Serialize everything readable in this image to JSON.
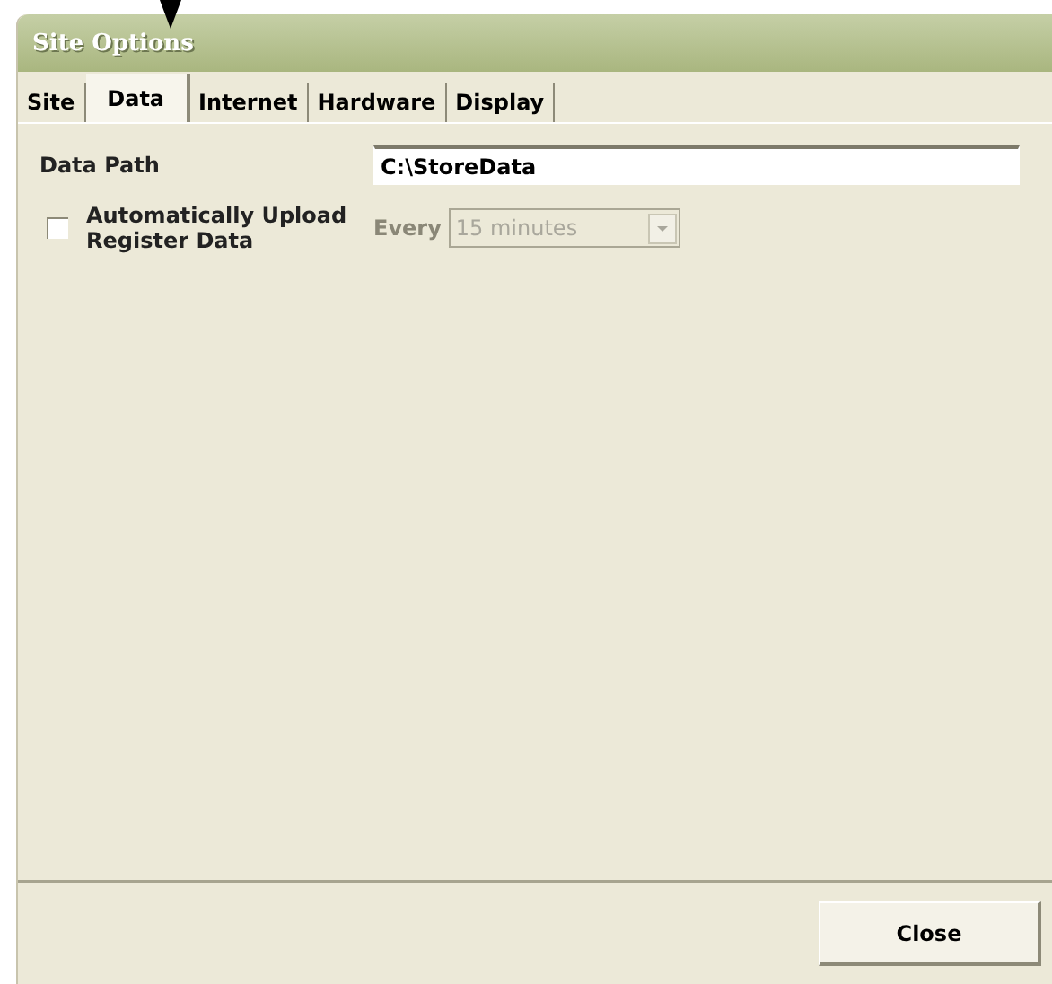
{
  "window": {
    "title": "Site Options"
  },
  "tabs": [
    {
      "label": "Site",
      "selected": false
    },
    {
      "label": "Data",
      "selected": true
    },
    {
      "label": "Internet",
      "selected": false
    },
    {
      "label": "Hardware",
      "selected": false
    },
    {
      "label": "Display",
      "selected": false
    }
  ],
  "data_path": {
    "label": "Data Path",
    "value": "C:\\StoreData"
  },
  "auto_upload": {
    "label": "Automatically Upload Register Data",
    "checked": false
  },
  "interval": {
    "label": "Every",
    "value": "15 minutes",
    "disabled": true
  },
  "buttons": [
    "Close"
  ]
}
